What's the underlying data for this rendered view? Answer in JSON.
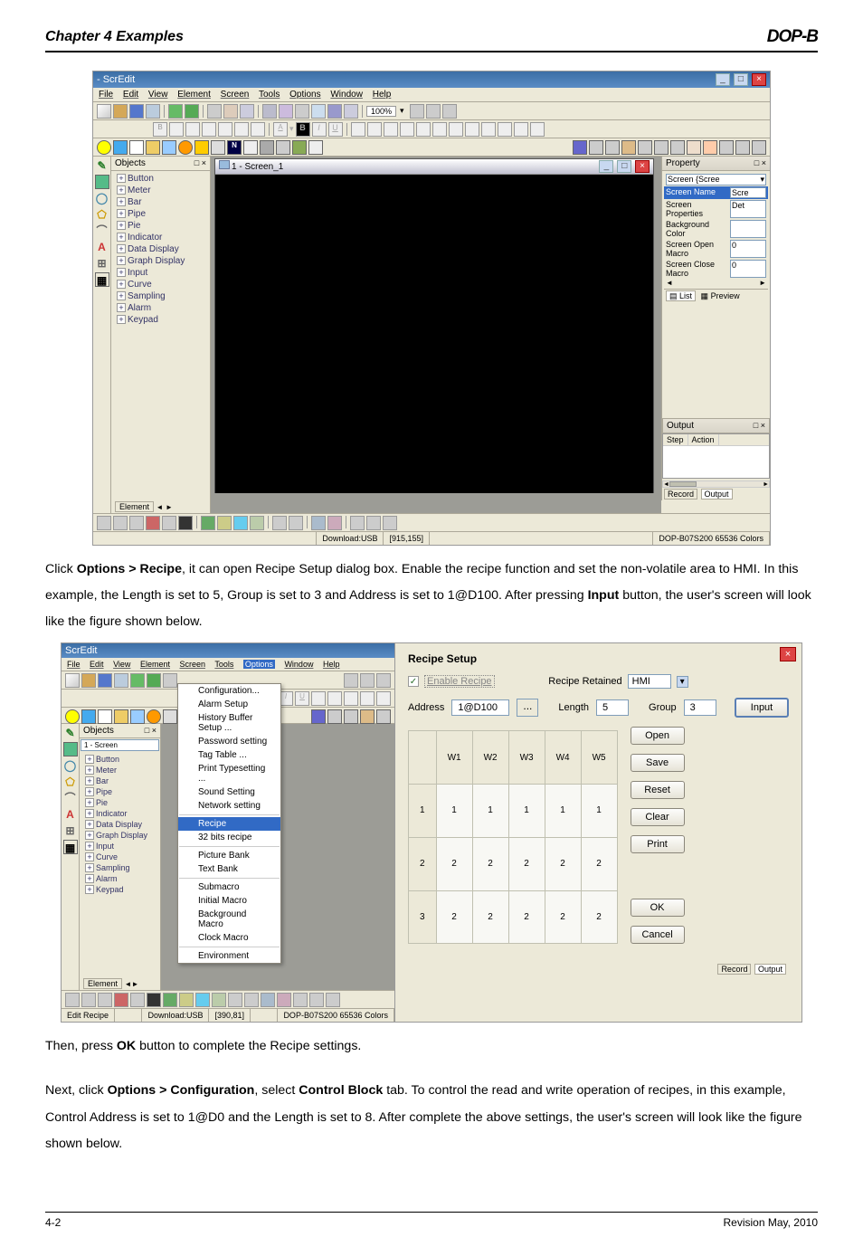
{
  "header": {
    "chapter": "Chapter 4 Examples",
    "logo": "DOP-B"
  },
  "ss1": {
    "title": "- ScrEdit",
    "menubar": [
      "File",
      "Edit",
      "View",
      "Element",
      "Screen",
      "Tools",
      "Options",
      "Window",
      "Help"
    ],
    "zoom": "100%",
    "objectsPanel": {
      "title": "Objects",
      "close": "□ ×",
      "items": [
        "Button",
        "Meter",
        "Bar",
        "Pipe",
        "Pie",
        "Indicator",
        "Data Display",
        "Graph Display",
        "Input",
        "Curve",
        "Sampling",
        "Alarm",
        "Keypad"
      ]
    },
    "screenWindow": {
      "title": "1 - Screen_1"
    },
    "property": {
      "title": "Property",
      "close": "□ ×",
      "selectorLabel": "Screen {Scree",
      "rows": [
        {
          "label": "Screen Name",
          "val": "Scre",
          "sel": true
        },
        {
          "label": "Screen Properties",
          "val": "Det"
        },
        {
          "label": "Background Color",
          "val": ""
        },
        {
          "label": "Screen Open Macro",
          "val": "0"
        },
        {
          "label": "Screen Close Macro",
          "val": "0"
        }
      ],
      "listTab": "List",
      "previewTab": "Preview"
    },
    "output": {
      "title": "Output",
      "close": "□ ×",
      "cols": [
        "Step",
        "Action"
      ]
    },
    "recordTabs": [
      "Record",
      "Output"
    ],
    "element": "Element",
    "statusbar": {
      "download": "Download:USB",
      "coords": "[915,155]",
      "device": "DOP-B07S200 65536 Colors"
    }
  },
  "paragraph1": "Click Options > Recipe, it can open Recipe Setup dialog box. Enable the recipe function and set the non-volatile area to HMI. In this example, the Length is set to 5, Group is set to 3 and Address is set to 1@D100. After pressing Input button, the user's screen will look like the figure shown below.",
  "ss2": {
    "title": "ScrEdit",
    "menubar": [
      "File",
      "Edit",
      "View",
      "Element",
      "Screen",
      "Tools",
      "Options",
      "Window",
      "Help"
    ],
    "objectsPanel": {
      "title": "Objects",
      "close": "□ ×",
      "screenTab": "1 - Screen",
      "items": [
        "Button",
        "Meter",
        "Bar",
        "Pipe",
        "Pie",
        "Indicator",
        "Data Display",
        "Graph Display",
        "Input",
        "Curve",
        "Sampling",
        "Alarm",
        "Keypad"
      ]
    },
    "optionsMenu": [
      "Configuration...",
      "Alarm Setup",
      "History Buffer Setup ...",
      "Password setting",
      "Tag Table ...",
      "Print Typesetting ...",
      "Sound Setting",
      "Network setting",
      "—",
      "Recipe",
      "32 bits recipe",
      "—",
      "Picture Bank",
      "Text Bank",
      "—",
      "Submacro",
      "Initial Macro",
      "Background Macro",
      "Clock Macro",
      "—",
      "Environment"
    ],
    "dialog": {
      "title": "Recipe Setup",
      "enableLabel": "Enable Recipe",
      "retainedLabel": "Recipe Retained",
      "retainedVal": "HMI",
      "addressLabel": "Address",
      "addressVal": "1@D100",
      "browse": "...",
      "lengthLabel": "Length",
      "lengthVal": "5",
      "groupLabel": "Group",
      "groupVal": "3",
      "buttons": {
        "input": "Input",
        "open": "Open",
        "save": "Save",
        "reset": "Reset",
        "clear": "Clear",
        "print": "Print",
        "ok": "OK",
        "cancel": "Cancel"
      },
      "table": {
        "cols": [
          "",
          "W1",
          "W2",
          "W3",
          "W4",
          "W5"
        ],
        "rows": [
          [
            "1",
            "1",
            "1",
            "1",
            "1",
            "1"
          ],
          [
            "2",
            "2",
            "2",
            "2",
            "2",
            "2"
          ],
          [
            "3",
            "2",
            "2",
            "2",
            "2",
            "2"
          ]
        ]
      }
    },
    "recordTabs": [
      "Record",
      "Output"
    ],
    "element": "Element",
    "statusbar": {
      "edit": "Edit Recipe",
      "download": "Download:USB",
      "coords": "[390,81]",
      "device": "DOP-B07S200 65536 Colors"
    }
  },
  "paragraph2": "Then, press OK button to complete the Recipe settings.",
  "paragraph3": "Next, click Options > Configuration, select Control Block tab. To control the read and write operation of recipes, in this example, Control Address is set to 1@D0 and the Length is set to 8. After complete the above settings, the user's screen will look like the figure shown below.",
  "footer": {
    "page": "4-2",
    "rev": "Revision May, 2010"
  }
}
